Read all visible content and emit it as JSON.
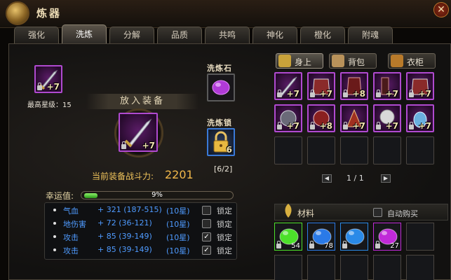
{
  "window": {
    "title": "炼器",
    "close_label": "✕"
  },
  "tabs": [
    {
      "label": "强化"
    },
    {
      "label": "洗炼"
    },
    {
      "label": "分解"
    },
    {
      "label": "品质"
    },
    {
      "label": "共鸣"
    },
    {
      "label": "神化"
    },
    {
      "label": "橙化"
    },
    {
      "label": "附魂"
    }
  ],
  "active_tab": "洗炼",
  "equip": {
    "top_item_level": "+7",
    "max_star_label": "最高星级：15",
    "put_in_label": "放入装备",
    "center_item_level": "+7",
    "power_label": "当前装备战斗力:",
    "power_value": "2201"
  },
  "stone": {
    "label": "洗炼石"
  },
  "lock_slot": {
    "label": "洗炼锁",
    "count": "6",
    "used": "[6/2]"
  },
  "luck": {
    "label": "幸运值:",
    "percent": 9,
    "percent_text": "9%"
  },
  "attributes": [
    {
      "name": "气血",
      "value": "+ 321 (187-515)",
      "star": "(10星)",
      "locked": false,
      "lock_label": "锁定"
    },
    {
      "name": "地伤害",
      "value": "+ 72 (36-121)",
      "star": "(10星)",
      "locked": false,
      "lock_label": "锁定"
    },
    {
      "name": "攻击",
      "value": "+ 85 (39-149)",
      "star": "(10星)",
      "locked": true,
      "lock_label": "锁定"
    },
    {
      "name": "攻击",
      "value": "+ 85 (39-149)",
      "star": "(10星)",
      "locked": true,
      "lock_label": "锁定"
    }
  ],
  "bag_tabs": [
    {
      "label": "身上",
      "icon": "armor-icon",
      "color": "#c9a23a"
    },
    {
      "label": "背包",
      "icon": "bag-icon",
      "color": "#b9925a"
    },
    {
      "label": "衣柜",
      "icon": "wardrobe-icon",
      "color": "#b87a2a"
    }
  ],
  "bag_items": [
    {
      "level": "+7",
      "kind": "sword"
    },
    {
      "level": "+7",
      "kind": "armor"
    },
    {
      "level": "+8",
      "kind": "gauntlet"
    },
    {
      "level": "+7",
      "kind": "boots"
    },
    {
      "level": "+7",
      "kind": "armor"
    },
    {
      "level": "+7",
      "kind": "helm"
    },
    {
      "level": "+8",
      "kind": "mask"
    },
    {
      "level": "+7",
      "kind": "claw"
    },
    {
      "level": "+7",
      "kind": "skull"
    },
    {
      "level": "+7",
      "kind": "pendant"
    }
  ],
  "pagination": {
    "text": "1 / 1",
    "prev": "◀",
    "next": "▶"
  },
  "materials": {
    "title": "材料",
    "auto_buy_label": "自动购买",
    "gems": [
      {
        "count": "54",
        "color": "#4ce02a"
      },
      {
        "count": "78",
        "color": "#2a7ae8"
      },
      {
        "count": "",
        "color": "#2a8ae8"
      },
      {
        "count": "27",
        "color": "#c02ad8"
      }
    ]
  }
}
